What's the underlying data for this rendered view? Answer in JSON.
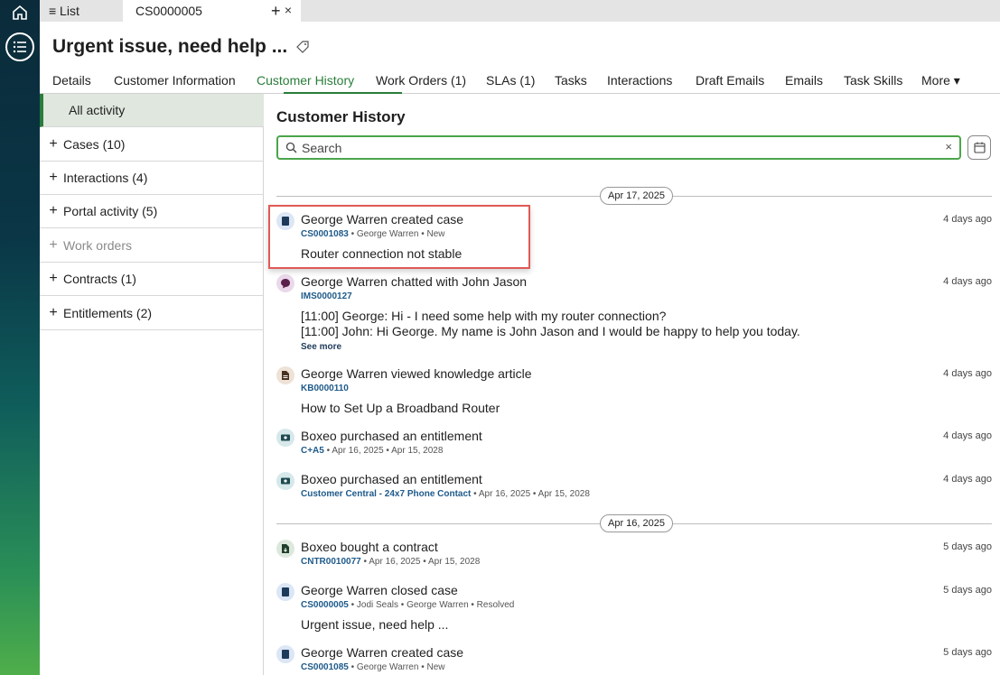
{
  "tabbar": {
    "list_label": "≡ List",
    "active_tab": "CS0000005",
    "close": "×",
    "plus": "+"
  },
  "record": {
    "title": "Urgent issue, need help ..."
  },
  "record_tabs": [
    "Details",
    "Customer Information",
    "Customer History",
    "Work Orders (1)",
    "SLAs (1)",
    "Tasks",
    "Interactions",
    "Draft Emails",
    "Emails",
    "Task Skills",
    "More ▾"
  ],
  "left_panel": {
    "all": "All activity",
    "items": [
      "Cases (10)",
      "Interactions (4)",
      "Portal activity (5)",
      "Work orders",
      "Contracts (1)",
      "Entitlements (2)"
    ]
  },
  "main": {
    "title": "Customer History",
    "search_placeholder": "Search",
    "clear": "×"
  },
  "dates": [
    "Apr 17, 2025",
    "Apr 16, 2025"
  ],
  "entries": [
    {
      "icon": "case-icon",
      "head": "George Warren created case",
      "id": "CS0001083",
      "meta": " • George Warren  • New",
      "lines": [
        "Router connection not stable"
      ],
      "ago": "4 days ago"
    },
    {
      "icon": "chat-icon",
      "head": "George Warren chatted with John Jason",
      "id": "IMS0000127",
      "meta": "",
      "lines": [
        "[11:00] George: Hi - I need some help with my router connection?",
        "[11:00] John: Hi George. My name is John Jason and I would be happy to help you today."
      ],
      "see_more": "See more",
      "ago": "4 days ago"
    },
    {
      "icon": "article-icon",
      "head": "George Warren viewed knowledge article",
      "id": "KB0000110",
      "meta": "",
      "lines": [
        "How to Set Up a Broadband Router"
      ],
      "ago": "4 days ago"
    },
    {
      "icon": "entitlement-icon",
      "head": "Boxeo purchased an entitlement",
      "id": "C+A5",
      "meta": " • Apr 16, 2025 • Apr 15, 2028",
      "lines": [],
      "ago": "4 days ago"
    },
    {
      "icon": "entitlement-icon",
      "head": "Boxeo purchased an entitlement",
      "id": "Customer Central - 24x7 Phone Contact",
      "meta": " • Apr 16, 2025 • Apr 15, 2028",
      "lines": [],
      "ago": "4 days ago"
    },
    {
      "icon": "contract-icon",
      "head": "Boxeo bought a contract",
      "id": "CNTR0010077",
      "meta": " • Apr 16, 2025 • Apr 15, 2028",
      "lines": [],
      "ago": "5 days ago"
    },
    {
      "icon": "case-icon",
      "head": "George Warren closed case",
      "id": "CS0000005",
      "meta": " • Jodi Seals  • George Warren  • Resolved",
      "lines": [
        "Urgent issue, need help ..."
      ],
      "ago": "5 days ago"
    },
    {
      "icon": "case-icon",
      "head": "George Warren created case",
      "id": "CS0001085",
      "meta": " • George Warren  • New",
      "lines": [],
      "ago": "5 days ago"
    }
  ],
  "colors": {
    "accent": "#2a7d3a",
    "link": "#1e5a8a",
    "highlight": "#e05a55"
  }
}
